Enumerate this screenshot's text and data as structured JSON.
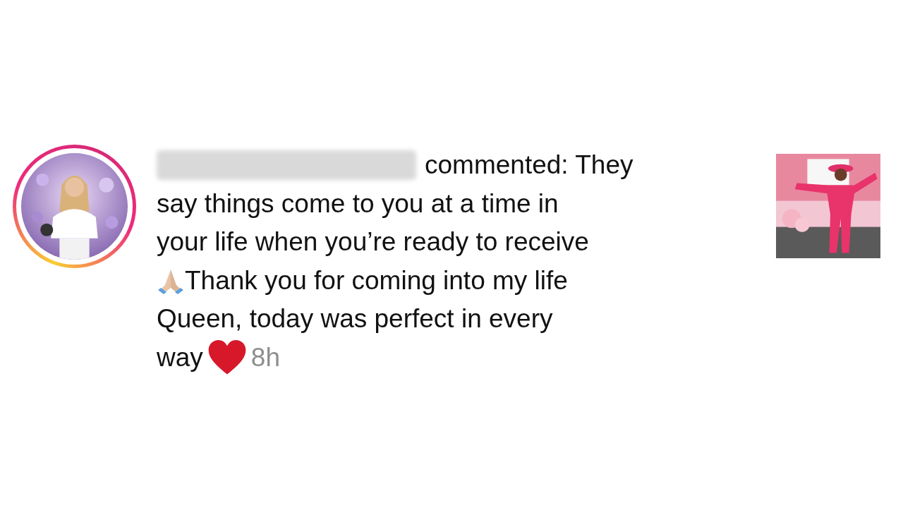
{
  "notification": {
    "avatar": {
      "kind": "picture",
      "story_ring": true
    },
    "comment_lines": [
      {
        "kind": "after-username",
        "text": "commented: They"
      },
      {
        "kind": "plain",
        "text": "say things come to you at a time in"
      },
      {
        "kind": "plain",
        "text": "your life when you’re ready to receive"
      },
      {
        "kind": "after-praying-hands",
        "text": "Thank you for coming into my life"
      },
      {
        "kind": "plain",
        "text": "Queen, today was perfect in every"
      },
      {
        "kind": "before-heart",
        "text": "way"
      }
    ],
    "time": "8h",
    "thumbnail": {
      "kind": "picture"
    }
  }
}
